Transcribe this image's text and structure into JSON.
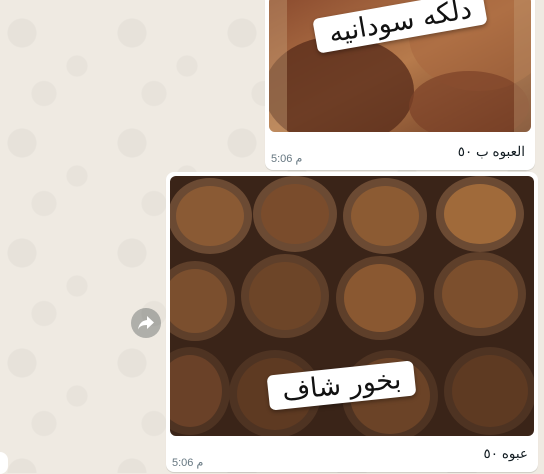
{
  "messages": [
    {
      "photo_label": "دلكه سودانيه",
      "caption": "العبوه ب ٥٠",
      "time": "5:06 م"
    },
    {
      "photo_label": "بخور شاف",
      "caption": "عبوه ٥٠",
      "time": "5:06 م"
    }
  ],
  "icons": {
    "forward": "forward-arrow-icon"
  }
}
